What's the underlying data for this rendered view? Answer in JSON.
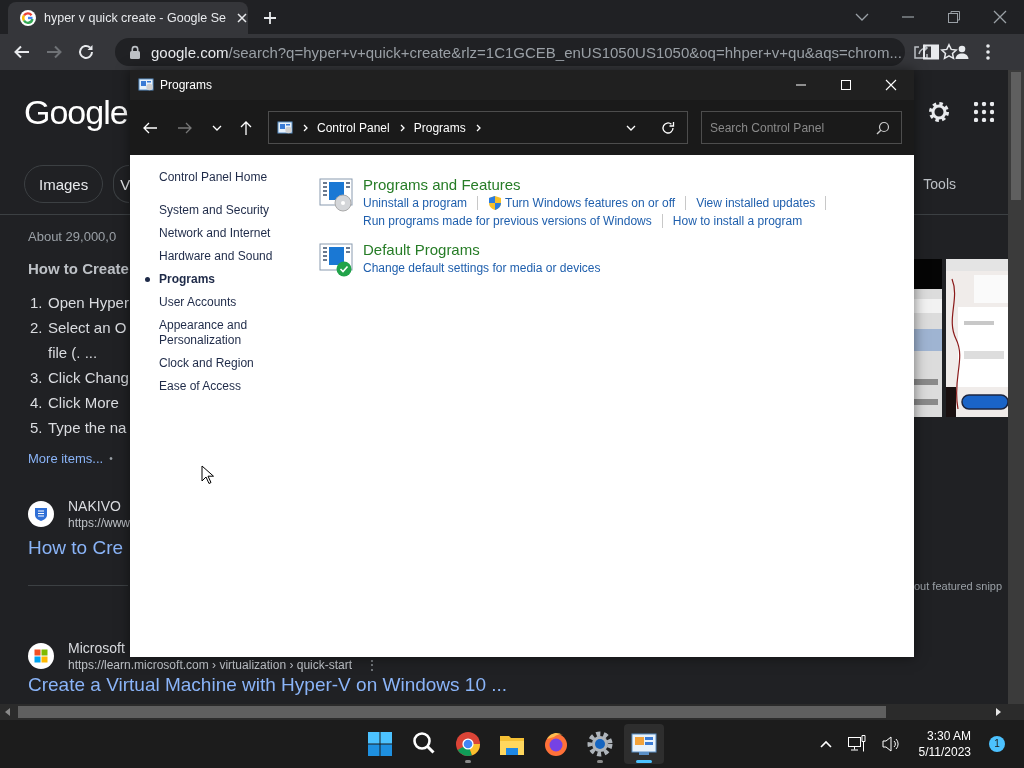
{
  "browser": {
    "tabs": [
      {
        "title": "hyper v quick create - Google Se",
        "selected": true
      }
    ],
    "forward_disabled": true,
    "address": {
      "host": "google.com",
      "path": "/search?q=hyper+v+quick+create&rlz=1C1GCEB_enUS1050US1050&oq=hhper+v+qu&aqs=chrom..."
    }
  },
  "search_page": {
    "logo": "Google",
    "chips": [
      {
        "label": "Images"
      },
      {
        "label": "V"
      }
    ],
    "tools": "Tools",
    "result_count": "About 29,000,0",
    "snippet_title": "How to Create",
    "steps": [
      {
        "number": "1.",
        "lines": [
          "Open Hyper"
        ]
      },
      {
        "number": "2.",
        "lines": [
          "Select an O",
          "file (. ..."
        ]
      },
      {
        "number": "3.",
        "lines": [
          "Click Chang"
        ]
      },
      {
        "number": "4.",
        "lines": [
          "Click More"
        ]
      },
      {
        "number": "5.",
        "lines": [
          "Type the na"
        ]
      }
    ],
    "more_items": "More items...",
    "more_separator": "•",
    "results": [
      {
        "kind": "nakivo",
        "source": "NAKIVO",
        "url": "https://www",
        "title": "How to Cre"
      },
      {
        "kind": "microsoft",
        "source": "Microsoft",
        "url": "https://learn.microsoft.com › virtualization › quick-start",
        "menu": "⋮",
        "title": "Create a Virtual Machine with Hyper-V on Windows 10 ..."
      }
    ],
    "featured_note": "out featured snipp"
  },
  "window": {
    "title": "Programs",
    "forward_disabled": true,
    "breadcrumb": [
      "Control Panel",
      "Programs"
    ],
    "search_placeholder": "Search Control Panel",
    "home_link": "Control Panel Home",
    "categories": [
      {
        "label": "System and Security",
        "selected": false
      },
      {
        "label": "Network and Internet",
        "selected": false
      },
      {
        "label": "Hardware and Sound",
        "selected": false
      },
      {
        "label": "Programs",
        "selected": true
      },
      {
        "label": "User Accounts",
        "selected": false
      },
      {
        "label": "Appearance and Personalization",
        "selected": false
      },
      {
        "label": "Clock and Region",
        "selected": false
      },
      {
        "label": "Ease of Access",
        "selected": false
      }
    ],
    "sections": [
      {
        "kind": "features",
        "title": "Programs and Features",
        "link_rows": [
          [
            {
              "text": "Uninstall a program",
              "shield": false
            },
            {
              "text": "Turn Windows features on or off",
              "shield": true
            },
            {
              "text": "View installed updates",
              "shield": false
            }
          ],
          [
            {
              "text": "Run programs made for previous versions of Windows",
              "shield": false
            },
            {
              "text": "How to install a program",
              "shield": false
            }
          ]
        ]
      },
      {
        "kind": "defaults",
        "title": "Default Programs",
        "link_rows": [
          [
            {
              "text": "Change default settings for media or devices",
              "shield": false
            }
          ]
        ]
      }
    ]
  },
  "taskbar": {
    "apps": [
      {
        "kind": "start",
        "running": false,
        "active": false
      },
      {
        "kind": "search",
        "running": false,
        "active": false
      },
      {
        "kind": "chrome",
        "running": true,
        "active": false
      },
      {
        "kind": "files",
        "running": false,
        "active": false
      },
      {
        "kind": "firefox",
        "running": false,
        "active": false
      },
      {
        "kind": "settings",
        "running": true,
        "active": false
      },
      {
        "kind": "control_panel",
        "running": true,
        "active": true
      }
    ],
    "time": "3:30 AM",
    "date": "5/11/2023",
    "notification_count": "1"
  }
}
